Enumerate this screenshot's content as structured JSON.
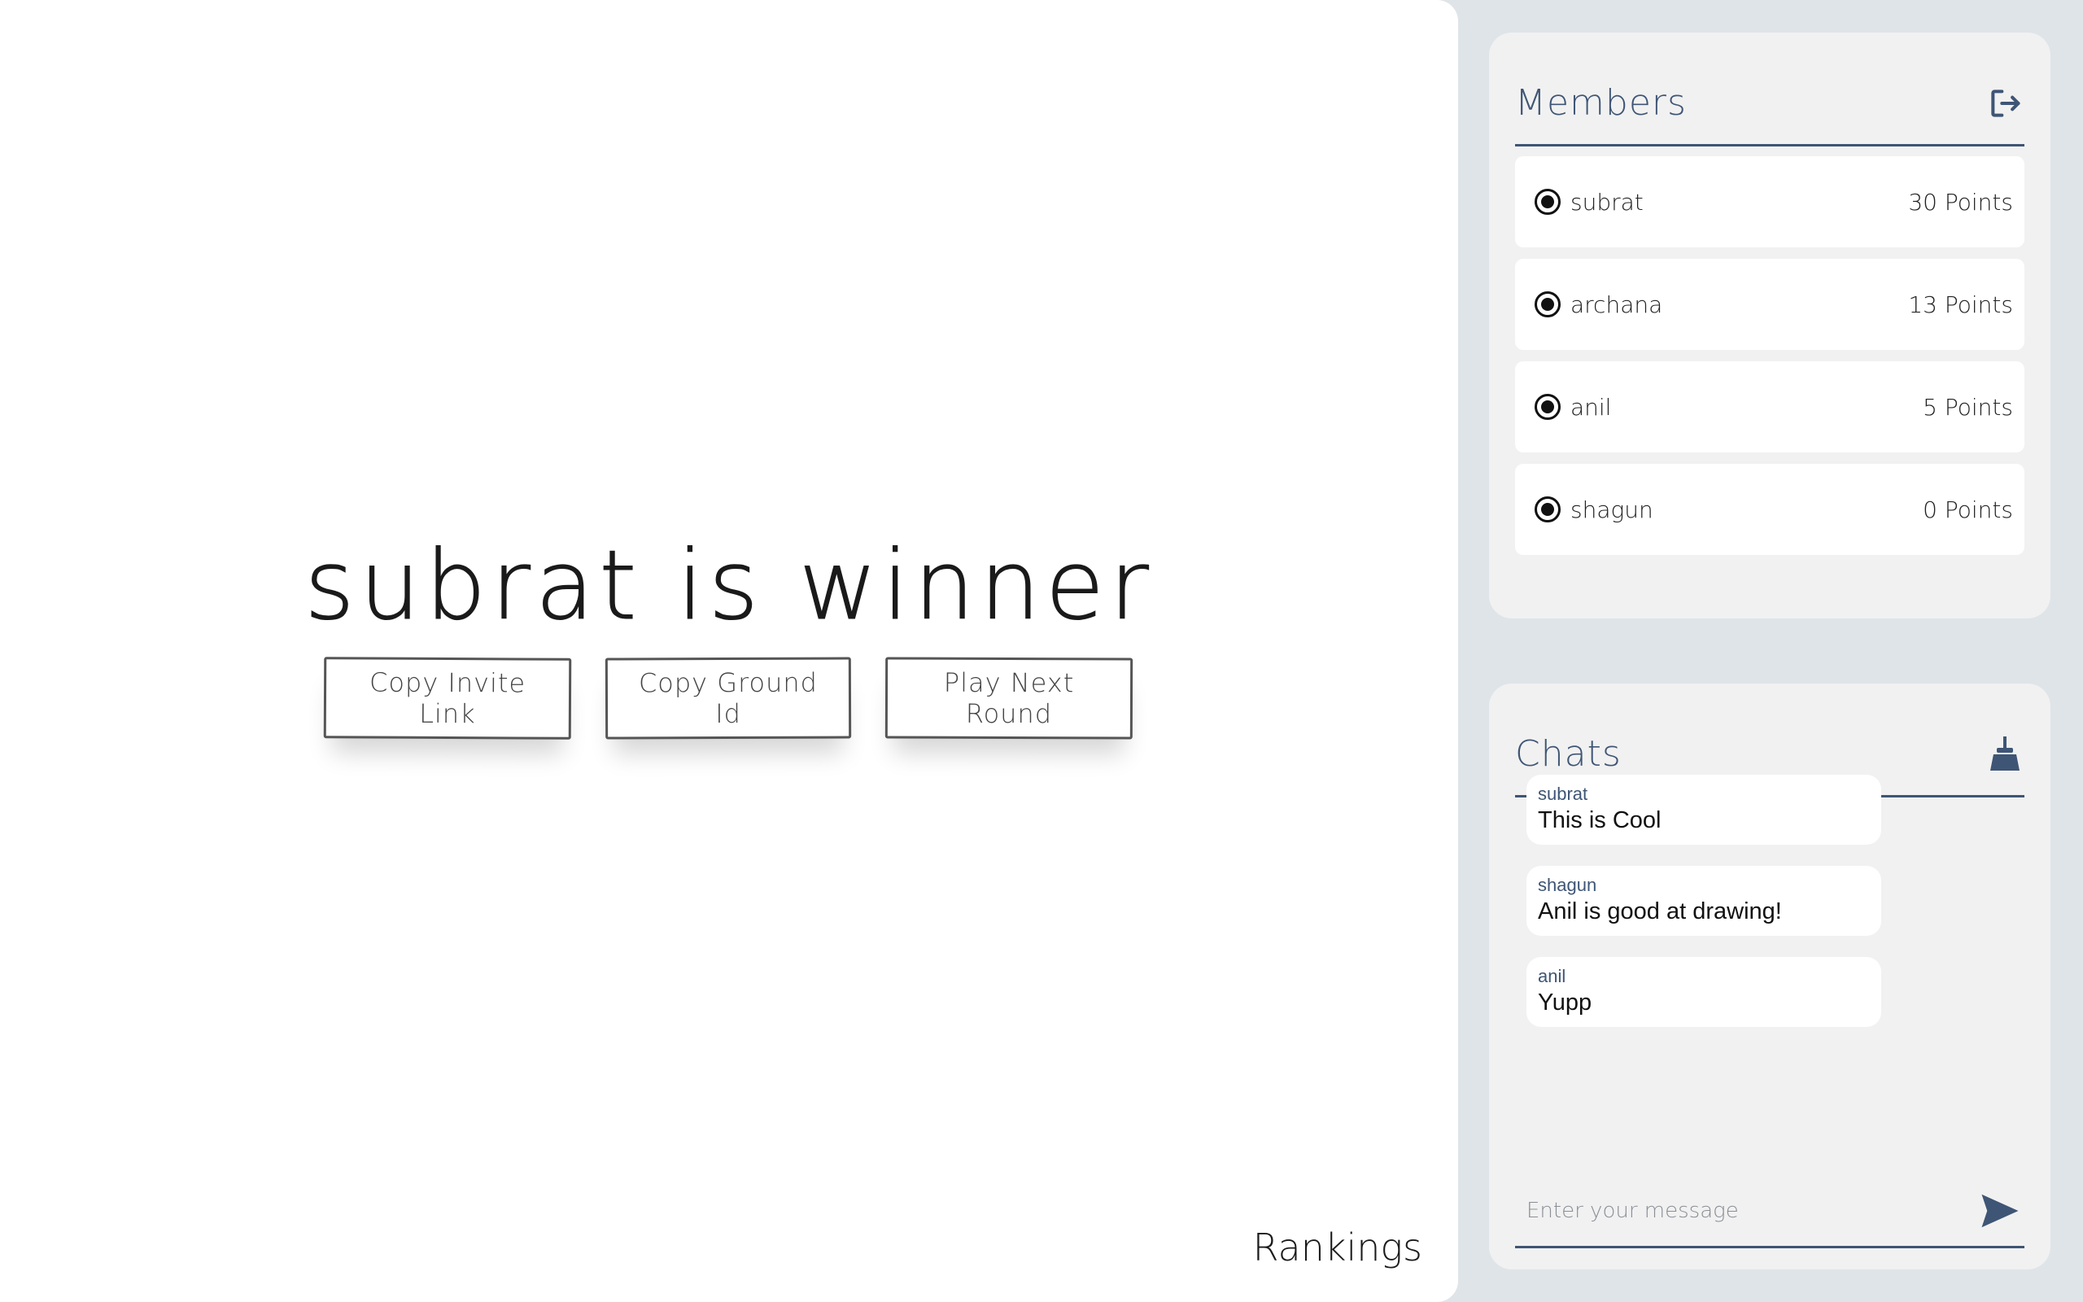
{
  "game": {
    "winner_text": "subrat is winner",
    "buttons": {
      "copy_invite": "Copy Invite Link",
      "copy_ground": "Copy Ground Id",
      "play_next": "Play Next Round"
    },
    "rankings_label": "Rankings"
  },
  "members": {
    "title": "Members",
    "exit_icon": "exit-icon",
    "items": [
      {
        "name": "subrat",
        "points": "30 Points"
      },
      {
        "name": "archana",
        "points": "13 Points"
      },
      {
        "name": "anil",
        "points": "5 Points"
      },
      {
        "name": "shagun",
        "points": "0 Points"
      }
    ]
  },
  "chats": {
    "title": "Chats",
    "clear_icon": "broom-icon",
    "messages": [
      {
        "user": "subrat",
        "text": "This is Cool"
      },
      {
        "user": "shagun",
        "text": "Anil is good at drawing!"
      },
      {
        "user": "anil",
        "text": "Yupp"
      }
    ],
    "input_placeholder": "Enter your message",
    "send_icon": "send-icon"
  },
  "colors": {
    "accent": "#3e5575",
    "panel_bg": "#f1f1f1",
    "page_bg": "#dfe4e8"
  }
}
